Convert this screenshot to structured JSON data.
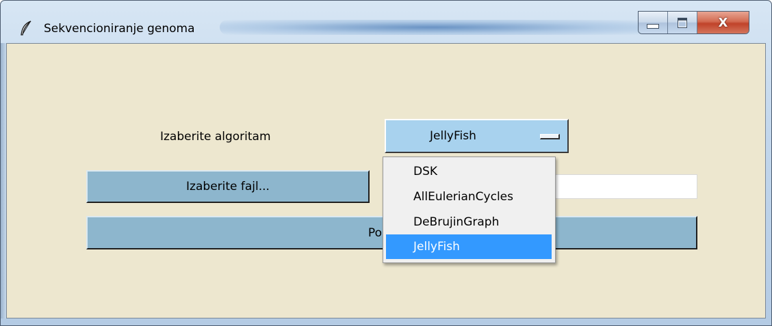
{
  "window": {
    "title": "Sekvencioniranje genoma",
    "icon": "feather-icon",
    "caption": {
      "minimize_icon": "minimize-icon",
      "maximize_icon": "maximize-icon",
      "close_label": "X"
    }
  },
  "form": {
    "algorithm_label": "Izaberite algoritam",
    "algorithm_selected": "JellyFish",
    "file_button_label": "Izaberite fajl...",
    "file_path_value": "",
    "run_button_label": "Pokrenit"
  },
  "dropdown": {
    "options": [
      "DSK",
      "AllEulerianCycles",
      "DeBrujinGraph",
      "JellyFish"
    ],
    "highlighted": "JellyFish"
  },
  "colors": {
    "client_background": "#ede7cf",
    "button_background": "#8db6cd",
    "select_background": "#a8d2ee",
    "menu_highlight": "#3399ff",
    "close_button": "#c0432a"
  }
}
